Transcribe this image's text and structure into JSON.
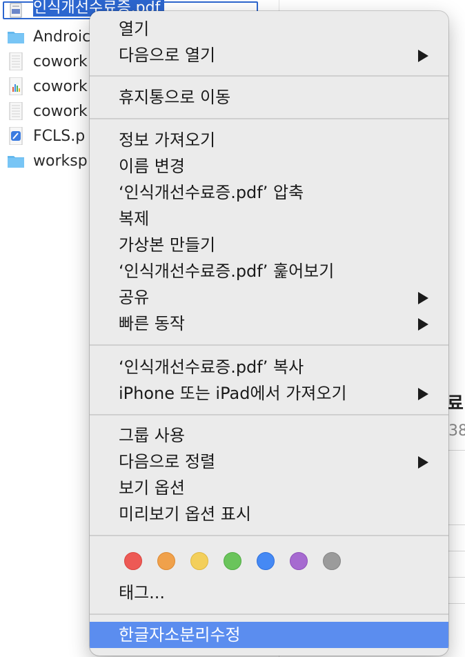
{
  "finder": {
    "files": [
      {
        "name": "인식개선수료증.pdf",
        "icon": "pdf-file-icon",
        "selected": true
      },
      {
        "name": "Androic",
        "icon": "folder-icon"
      },
      {
        "name": "cowork",
        "icon": "spreadsheet-file-icon"
      },
      {
        "name": "cowork",
        "icon": "chart-file-icon"
      },
      {
        "name": "cowork",
        "icon": "spreadsheet-file-icon"
      },
      {
        "name": "FCLS.p",
        "icon": "app-file-icon"
      },
      {
        "name": "worksp",
        "icon": "folder-icon"
      }
    ],
    "right_fragment_title": "료",
    "right_fragment_sub": "38"
  },
  "menu": {
    "groups": [
      [
        {
          "label": "열기",
          "submenu": false
        },
        {
          "label": "다음으로 열기",
          "submenu": true
        }
      ],
      [
        {
          "label": "휴지통으로 이동",
          "submenu": false
        }
      ],
      [
        {
          "label": "정보 가져오기",
          "submenu": false
        },
        {
          "label": "이름 변경",
          "submenu": false
        },
        {
          "label": "‘인식개선수료증.pdf’ 압축",
          "submenu": false
        },
        {
          "label": "복제",
          "submenu": false
        },
        {
          "label": "가상본 만들기",
          "submenu": false
        },
        {
          "label": "‘인식개선수료증.pdf’ 훑어보기",
          "submenu": false
        },
        {
          "label": "공유",
          "submenu": true
        },
        {
          "label": "빠른 동작",
          "submenu": true
        }
      ],
      [
        {
          "label": "‘인식개선수료증.pdf’ 복사",
          "submenu": false
        },
        {
          "label": "iPhone 또는 iPad에서 가져오기",
          "submenu": true
        }
      ],
      [
        {
          "label": "그룹 사용",
          "submenu": false
        },
        {
          "label": "다음으로 정렬",
          "submenu": true
        },
        {
          "label": "보기 옵션",
          "submenu": false
        },
        {
          "label": "미리보기 옵션 표시",
          "submenu": false
        }
      ]
    ],
    "tag_colors": [
      {
        "name": "red",
        "fill": "#ed5a55",
        "border": "#d9453f"
      },
      {
        "name": "orange",
        "fill": "#f0a14b",
        "border": "#dd8a33"
      },
      {
        "name": "yellow",
        "fill": "#f3cf5b",
        "border": "#dfb842"
      },
      {
        "name": "green",
        "fill": "#6ac45b",
        "border": "#52ad44"
      },
      {
        "name": "blue",
        "fill": "#4589f4",
        "border": "#2f71dc"
      },
      {
        "name": "purple",
        "fill": "#a66ad0",
        "border": "#8f52ba"
      },
      {
        "name": "gray",
        "fill": "#9b9b9b",
        "border": "#858585"
      }
    ],
    "tags_label": "태그...",
    "service_item": "한글자소분리수정",
    "highlight_color": "#5b8def"
  }
}
